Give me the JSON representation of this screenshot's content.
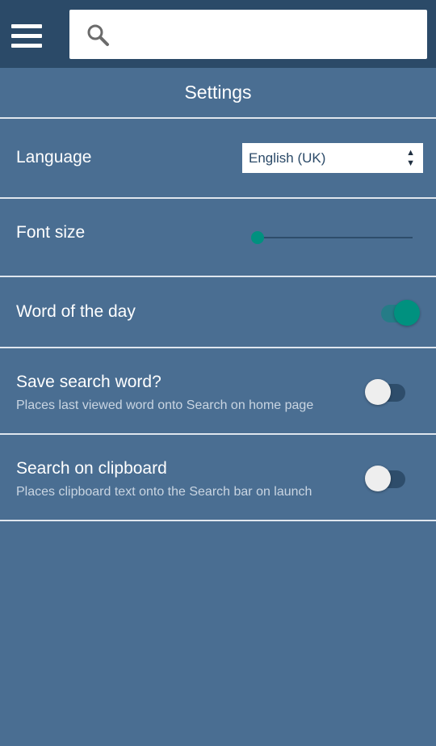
{
  "header": {
    "menu_icon": "hamburger-menu-icon",
    "search_icon": "search-icon",
    "search_value": "",
    "search_placeholder": ""
  },
  "page": {
    "title": "Settings"
  },
  "settings": {
    "language": {
      "label": "Language",
      "selected": "English (UK)"
    },
    "font_size": {
      "label": "Font size",
      "value_fraction": 0.0
    },
    "word_of_day": {
      "label": "Word of the day",
      "enabled": true
    },
    "save_search": {
      "label": "Save search word?",
      "description": "Places last viewed word onto Search on home page",
      "enabled": false
    },
    "clipboard_search": {
      "label": "Search on clipboard",
      "description": "Places clipboard text onto the Search bar on launch",
      "enabled": false
    }
  },
  "colors": {
    "background": "#4a6e92",
    "topbar": "#2b4a68",
    "accent": "#00917f"
  }
}
